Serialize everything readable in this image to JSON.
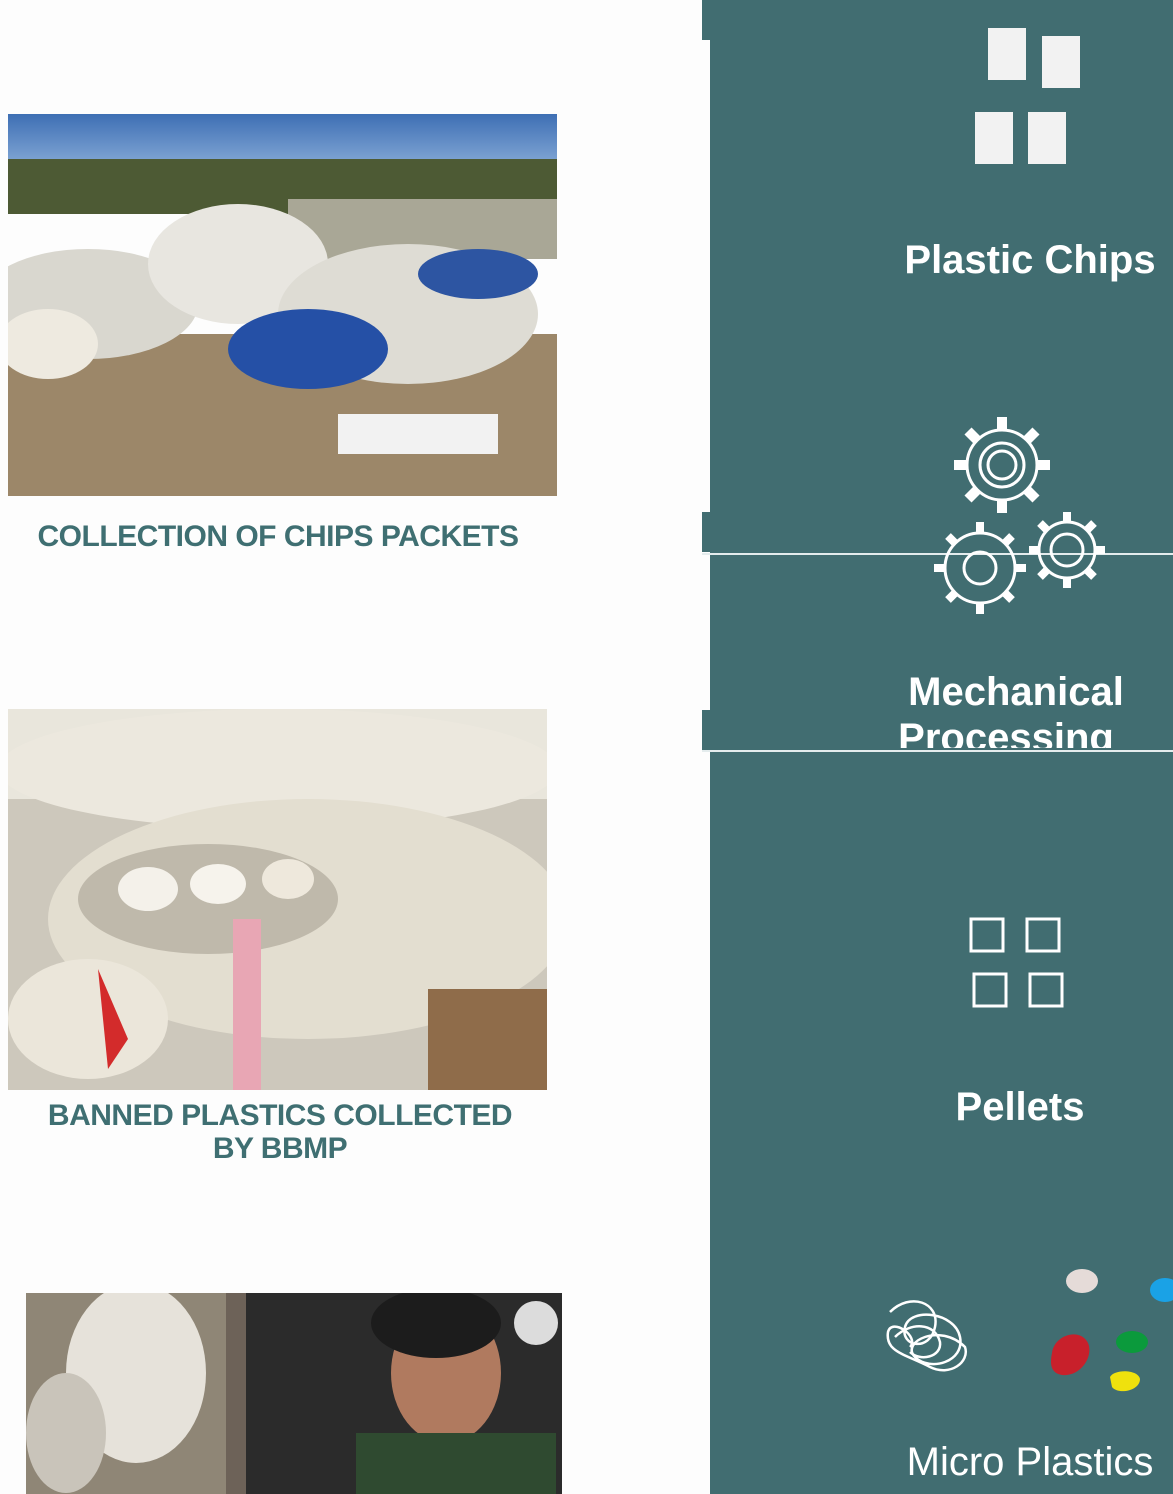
{
  "gallery": [
    {
      "caption": "COLLECTION OF CHIPS PACKETS",
      "alt": "photo"
    },
    {
      "caption": "BANNED PLASTICS COLLECTED BY BBMP",
      "alt": "photo"
    },
    {
      "caption": "",
      "alt": "photo"
    }
  ],
  "steps": [
    {
      "title": "Plastic Chips",
      "icon": "chips-blocks-icon"
    },
    {
      "title": "Mechanical",
      "title2": "Processing",
      "icon": "gears-icon"
    },
    {
      "title": "Pellets",
      "icon": "pellet-squares-icon"
    },
    {
      "title": "Micro Plastics",
      "icon": "scribble-icon"
    }
  ],
  "colors": {
    "panel": "#416d71",
    "caption": "#3f6f72",
    "dot_white": "#e5dbd8",
    "dot_blue": "#1aa2e6",
    "dot_red": "#c8202b",
    "dot_green": "#0b9a3c",
    "dot_yellow": "#efe10d"
  }
}
